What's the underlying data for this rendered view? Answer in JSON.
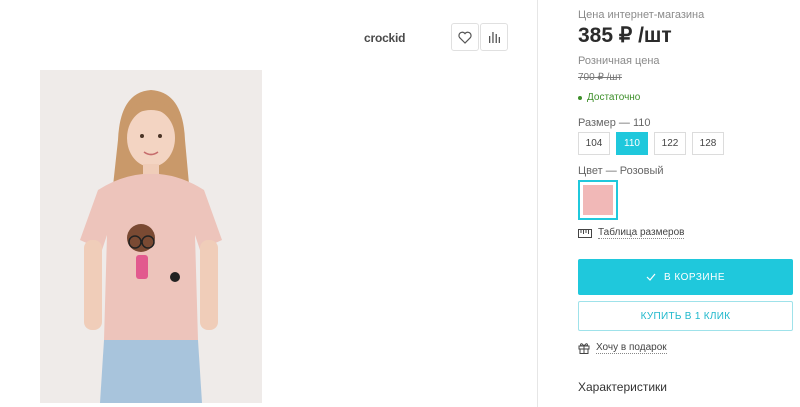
{
  "header": {
    "brand": "crockid"
  },
  "price_block": {
    "label": "Цена интернет-магазина",
    "price": "385 ₽ /шт",
    "retail_label": "Розничная цена",
    "old_price": "700 ₽ /шт",
    "stock": "Достаточно"
  },
  "size": {
    "label": "Размер",
    "selected": "110",
    "options": [
      "104",
      "110",
      "122",
      "128"
    ]
  },
  "color": {
    "label": "Цвет",
    "selected": "Розовый",
    "swatch_hex": "#f1b8b7"
  },
  "actions": {
    "size_table": "Таблица размеров",
    "in_cart": "В КОРЗИНЕ",
    "buy_one_click": "КУПИТЬ В 1 КЛИК",
    "gift": "Хочу в подарок"
  },
  "sections": {
    "characteristics": "Характеристики"
  },
  "icons": {
    "favorite": "heart-icon",
    "compare": "bar-chart-icon",
    "size_table": "ruler-icon",
    "cart_check": "check-icon",
    "gift": "gift-icon"
  },
  "colors": {
    "accent": "#1fc8dc",
    "stock": "#3d8f2a"
  }
}
